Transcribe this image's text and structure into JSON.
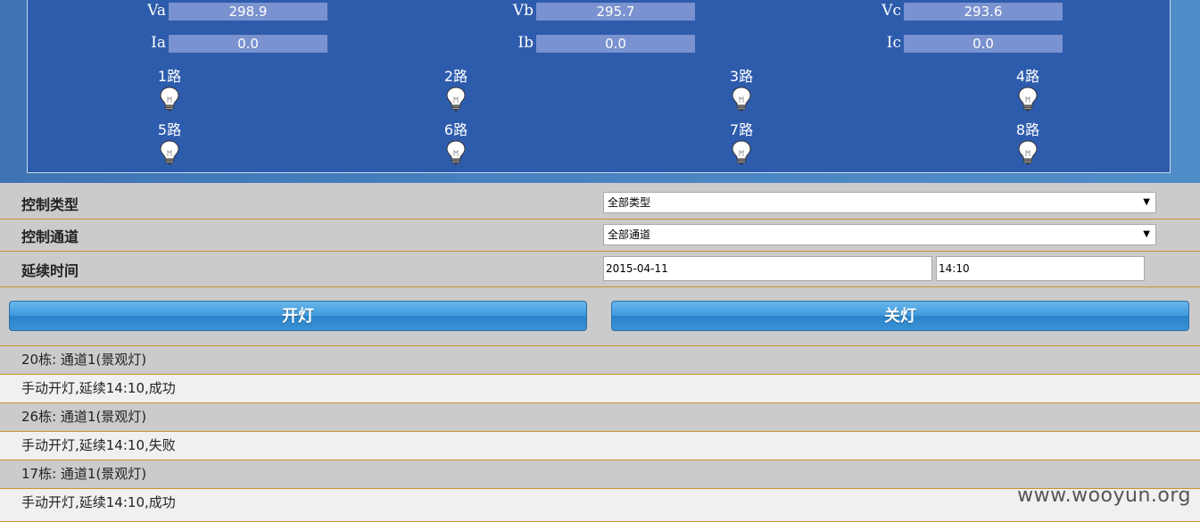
{
  "meters": {
    "va": {
      "label": "Va",
      "value": "298.9"
    },
    "vb": {
      "label": "Vb",
      "value": "295.7"
    },
    "vc": {
      "label": "Vc",
      "value": "293.6"
    },
    "ia": {
      "label": "Ia",
      "value": "0.0"
    },
    "ib": {
      "label": "Ib",
      "value": "0.0"
    },
    "ic": {
      "label": "Ic",
      "value": "0.0"
    }
  },
  "lamps": [
    "1路",
    "2路",
    "3路",
    "4路",
    "5路",
    "6路",
    "7路",
    "8路"
  ],
  "form": {
    "control_type_label": "控制类型",
    "control_type_value": "全部类型",
    "control_channel_label": "控制通道",
    "control_channel_value": "全部通道",
    "duration_label": "延续时间",
    "date_value": "2015-04-11",
    "time_value": "14:10"
  },
  "buttons": {
    "on": "开灯",
    "off": "关灯"
  },
  "logs": [
    "20栋: 通道1(景观灯)",
    "手动开灯,延续14:10,成功",
    "26栋: 通道1(景观灯)",
    "手动开灯,延续14:10,失败",
    "17栋: 通道1(景观灯)",
    "手动开灯,延续14:10,成功"
  ],
  "watermark": "www.wooyun.org"
}
